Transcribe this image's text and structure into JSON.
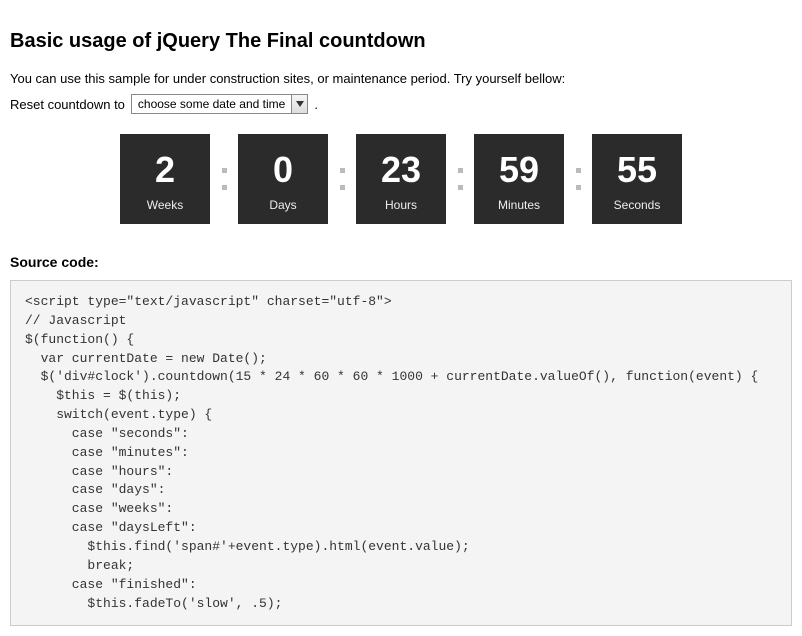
{
  "title": "Basic usage of jQuery The Final countdown",
  "intro": "You can use this sample for under construction sites, or maintenance period. Try yourself bellow:",
  "reset_label": "Reset countdown to",
  "select_placeholder": "choose some date and time",
  "period": ".",
  "countdown": [
    {
      "value": "2",
      "label": "Weeks"
    },
    {
      "value": "0",
      "label": "Days"
    },
    {
      "value": "23",
      "label": "Hours"
    },
    {
      "value": "59",
      "label": "Minutes"
    },
    {
      "value": "55",
      "label": "Seconds"
    }
  ],
  "source_heading": "Source code:",
  "source_code": "<script type=\"text/javascript\" charset=\"utf-8\">\n// Javascript\n$(function() {\n  var currentDate = new Date();\n  $('div#clock').countdown(15 * 24 * 60 * 60 * 1000 + currentDate.valueOf(), function(event) {\n    $this = $(this);\n    switch(event.type) {\n      case \"seconds\":\n      case \"minutes\":\n      case \"hours\":\n      case \"days\":\n      case \"weeks\":\n      case \"daysLeft\":\n        $this.find('span#'+event.type).html(event.value);\n        break;\n      case \"finished\":\n        $this.fadeTo('slow', .5);"
}
